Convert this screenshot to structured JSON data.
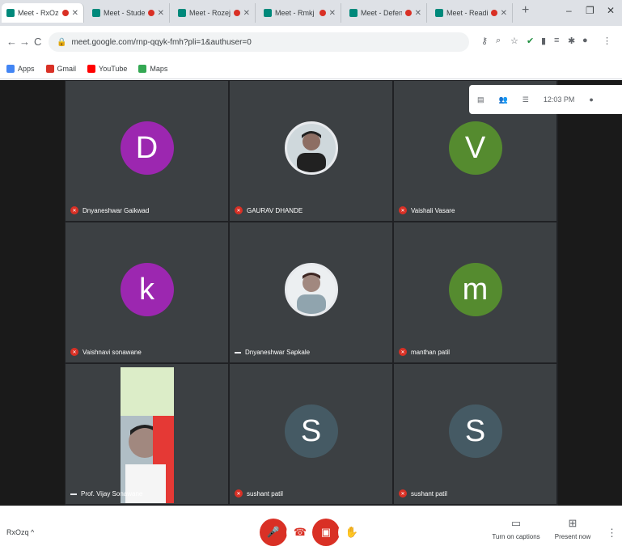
{
  "browser": {
    "tabs": [
      {
        "label": "Meet - RxOzq"
      },
      {
        "label": "Meet - Students"
      },
      {
        "label": "Meet - Rozej"
      },
      {
        "label": "Meet - Rmkj"
      },
      {
        "label": "Meet - Defence"
      },
      {
        "label": "Meet - Readify"
      }
    ],
    "new_tab": "+",
    "minimize": "–",
    "maximize": "❐",
    "close": "✕",
    "url": "meet.google.com/rnp-qqyk-fmh?pli=1&authuser=0",
    "bookmarks": [
      {
        "label": "Apps",
        "color": "#4285f4"
      },
      {
        "label": "Gmail",
        "color": "#d93025"
      },
      {
        "label": "YouTube",
        "color": "#ff0000"
      },
      {
        "label": "Maps",
        "color": "#34a853"
      }
    ]
  },
  "meeting": {
    "time": "12:03 PM",
    "participants": [
      {
        "name": "Dnyaneshwar Gaikwad",
        "initial": "D",
        "color": "#9c27b0",
        "type": "avatar",
        "muted": true
      },
      {
        "name": "GAURAV DHANDE",
        "initial": "",
        "color": "#e8eaed",
        "type": "photo",
        "muted": true
      },
      {
        "name": "Vaishali Vasare",
        "initial": "V",
        "color": "#558b2f",
        "type": "avatar",
        "muted": true
      },
      {
        "name": "Vaishnavi sonawane",
        "initial": "k",
        "color": "#9c27b0",
        "type": "avatar",
        "muted": true
      },
      {
        "name": "Dnyaneshwar Sapkale",
        "initial": "",
        "color": "#e8eaed",
        "type": "photo",
        "muted": false
      },
      {
        "name": "manthan patil",
        "initial": "m",
        "color": "#558b2f",
        "type": "avatar",
        "muted": true
      },
      {
        "name": "Prof. Vijay Sonawane",
        "initial": "",
        "color": "#ffffff",
        "type": "video",
        "muted": false
      },
      {
        "name": "sushant patil",
        "initial": "S",
        "color": "#455a64",
        "type": "avatar",
        "muted": true
      },
      {
        "name": "sushant patil",
        "initial": "S",
        "color": "#455a64",
        "type": "avatar",
        "muted": true
      }
    ],
    "meeting_code": "RxOzq",
    "controls": {
      "captions_label": "Turn on captions",
      "present_label": "Present now"
    }
  }
}
